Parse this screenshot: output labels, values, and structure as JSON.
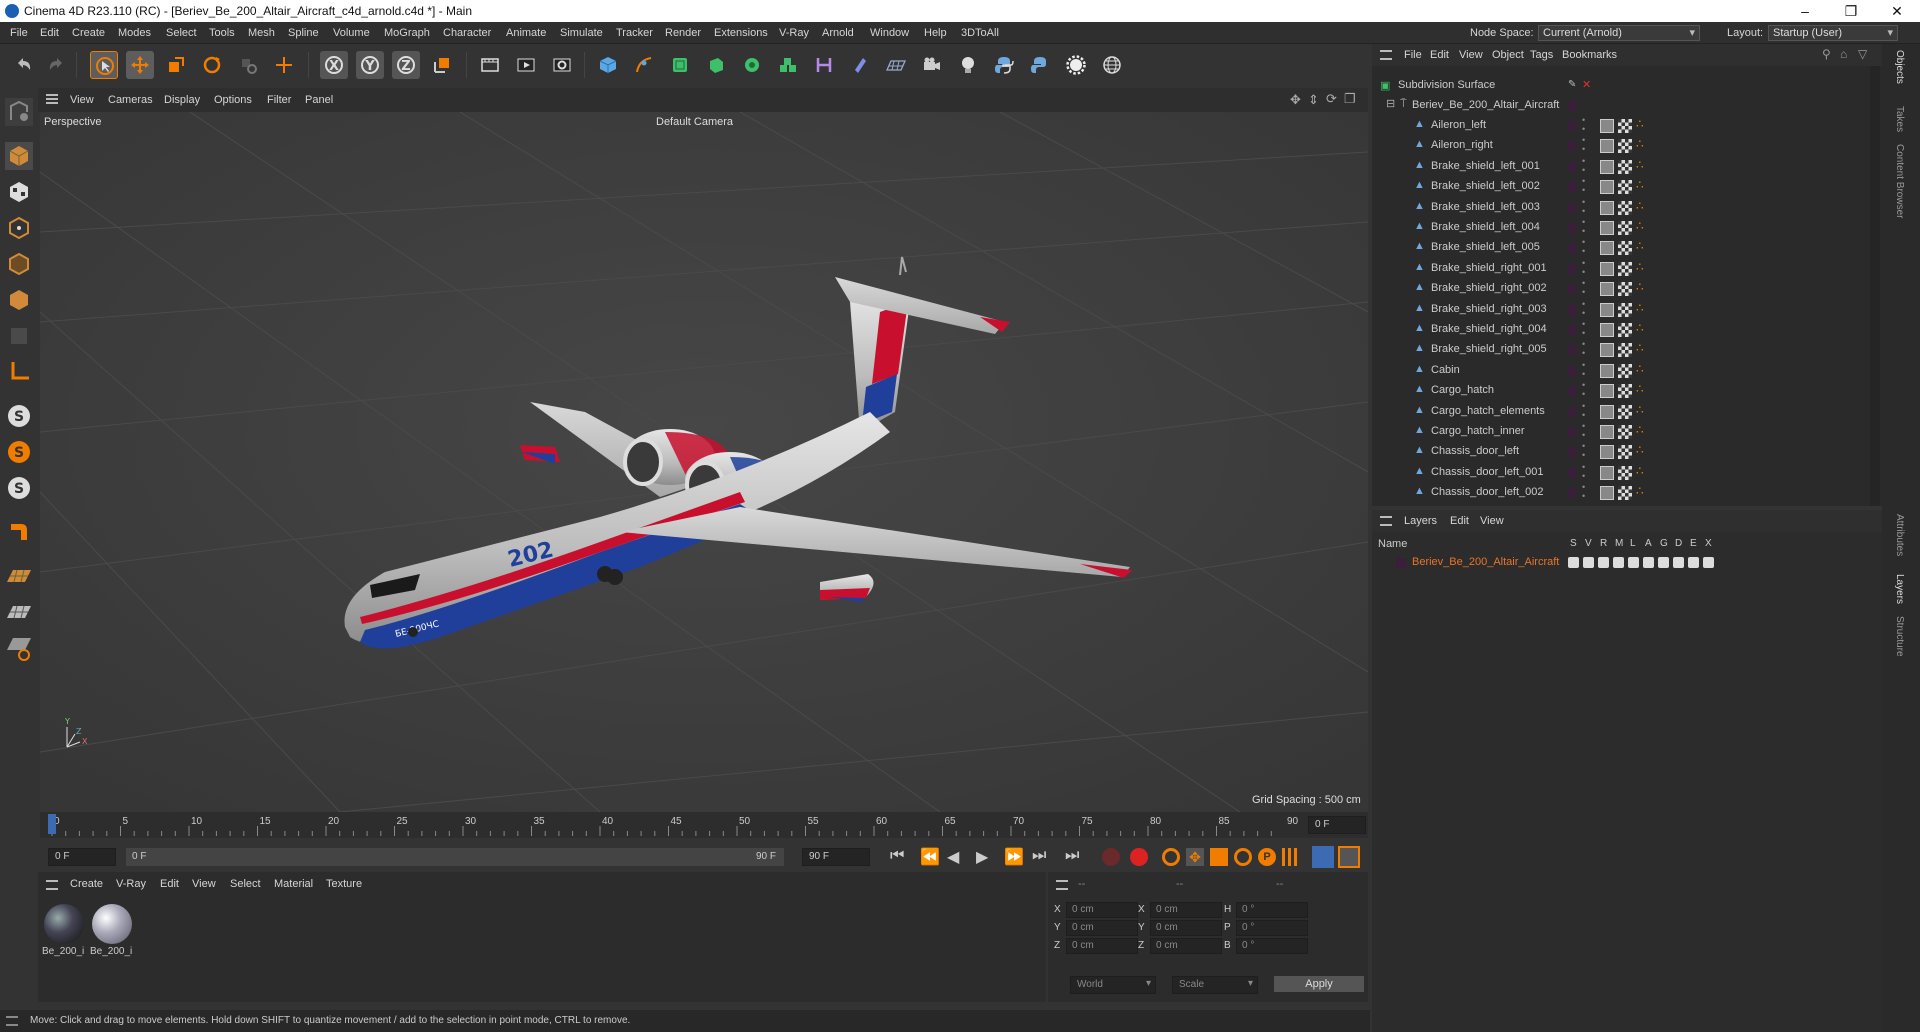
{
  "window": {
    "title": "Cinema 4D R23.110 (RC) - [Beriev_Be_200_Altair_Aircraft_c4d_arnold.c4d *] - Main"
  },
  "menu": {
    "items": [
      "File",
      "Edit",
      "Create",
      "Modes",
      "Select",
      "Tools",
      "Mesh",
      "Spline",
      "Volume",
      "MoGraph",
      "Character",
      "Animate",
      "Simulate",
      "Tracker",
      "Render",
      "Extensions",
      "V-Ray",
      "Arnold",
      "Window",
      "Help",
      "3DToAll"
    ],
    "node_space_label": "Node Space:",
    "node_space_value": "Current (Arnold)",
    "layout_label": "Layout:",
    "layout_value": "Startup (User)"
  },
  "viewport": {
    "menu": [
      "View",
      "Cameras",
      "Display",
      "Options",
      "Filter",
      "Panel"
    ],
    "label": "Perspective",
    "camera": "Default Camera",
    "grid_spacing": "Grid Spacing : 500 cm",
    "tail_number": "202",
    "nose_text": "БЕ-200ЧС"
  },
  "timeline": {
    "ticks": [
      "0",
      "5",
      "10",
      "15",
      "20",
      "25",
      "30",
      "35",
      "40",
      "45",
      "50",
      "55",
      "60",
      "65",
      "70",
      "75",
      "80",
      "85",
      "90"
    ],
    "frame_right": "0 F"
  },
  "transport": {
    "start": "0 F",
    "current": "0 F",
    "end_inner": "90 F",
    "end": "90 F"
  },
  "material_panel": {
    "menu": [
      "Create",
      "V-Ray",
      "Edit",
      "View",
      "Select",
      "Material",
      "Texture"
    ],
    "materials": [
      "Be_200_i",
      "Be_200_i"
    ]
  },
  "coords": {
    "col_headers": [
      "--",
      "--",
      "--"
    ],
    "rows": [
      {
        "a": "X",
        "av": "0 cm",
        "b": "X",
        "bv": "0 cm",
        "c": "H",
        "cv": "0 °"
      },
      {
        "a": "Y",
        "av": "0 cm",
        "b": "Y",
        "bv": "0 cm",
        "c": "P",
        "cv": "0 °"
      },
      {
        "a": "Z",
        "av": "0 cm",
        "b": "Z",
        "bv": "0 cm",
        "c": "B",
        "cv": "0 °"
      }
    ],
    "world": "World",
    "scale": "Scale",
    "apply": "Apply"
  },
  "status": "Move: Click and drag to move elements. Hold down SHIFT to quantize movement / add to the selection in point mode, CTRL to remove.",
  "objects": {
    "menu": [
      "File",
      "Edit",
      "View",
      "Object",
      "Tags",
      "Bookmarks"
    ],
    "root": "Subdivision Surface",
    "group": "Beriev_Be_200_Altair_Aircraft",
    "items": [
      "Aileron_left",
      "Aileron_right",
      "Brake_shield_left_001",
      "Brake_shield_left_002",
      "Brake_shield_left_003",
      "Brake_shield_left_004",
      "Brake_shield_left_005",
      "Brake_shield_right_001",
      "Brake_shield_right_002",
      "Brake_shield_right_003",
      "Brake_shield_right_004",
      "Brake_shield_right_005",
      "Cabin",
      "Cargo_hatch",
      "Cargo_hatch_elements",
      "Cargo_hatch_inner",
      "Chassis_door_left",
      "Chassis_door_left_001",
      "Chassis_door_left_002"
    ]
  },
  "layers": {
    "menu": [
      "Layers",
      "Edit",
      "View"
    ],
    "name_header": "Name",
    "flags": [
      "S",
      "V",
      "R",
      "M",
      "L",
      "A",
      "G",
      "D",
      "E",
      "X"
    ],
    "layer": "Beriev_Be_200_Altair_Aircraft"
  },
  "sidetabs": {
    "top": [
      "Objects",
      "Takes",
      "Content Browser"
    ],
    "bottom": [
      "Attributes",
      "Layers",
      "Structure"
    ]
  },
  "colors": {
    "accent_orange": "#f07c00",
    "layer_name": "#e8742a",
    "selected_blue": "#3d6bb3"
  }
}
